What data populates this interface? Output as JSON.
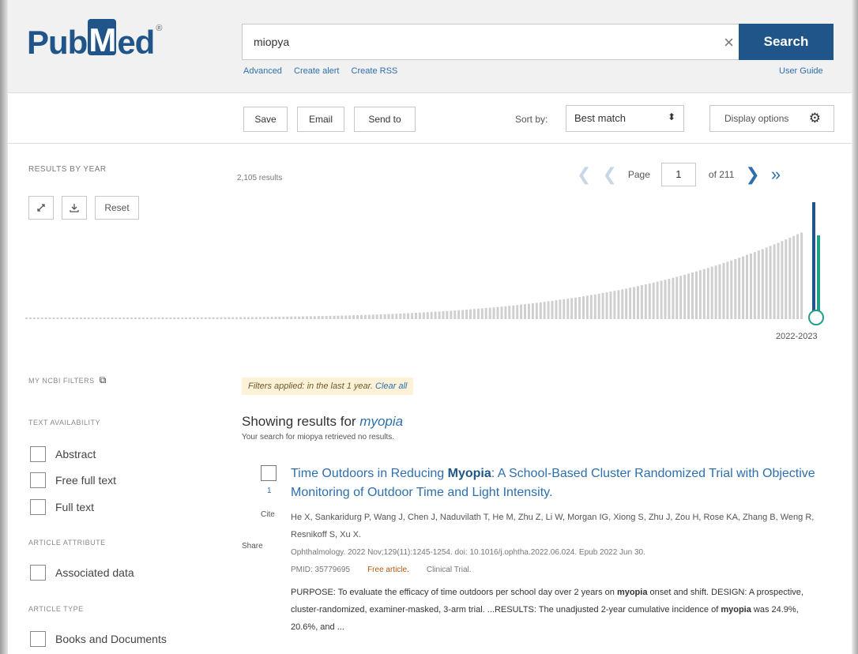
{
  "header": {
    "logo_pub": "Pub",
    "logo_m": "M",
    "logo_ed": "ed",
    "logo_reg": "®",
    "search_value": "miopya",
    "clear_glyph": "×",
    "search_button": "Search",
    "links": [
      "Advanced",
      "Create alert",
      "Create RSS"
    ],
    "user_guide": "User Guide"
  },
  "toolbar": {
    "save": "Save",
    "email": "Email",
    "send_to": "Send to",
    "sort_by_label": "Sort by:",
    "sort_value": "Best match",
    "display_options": "Display options"
  },
  "timeline": {
    "title": "RESULTS BY YEAR",
    "reset": "Reset",
    "results_count": "2,105 results",
    "page_label": "Page",
    "page_value": "1",
    "of_pages": "of 211",
    "year_range": "2022-2023",
    "accent_color": "#20a08a",
    "bar_color": "#cfcfcf"
  },
  "sidebar": {
    "my_ncbi_filters": "MY NCBI FILTERS",
    "text_availability": "TEXT AVAILABILITY",
    "text_options": [
      "Abstract",
      "Free full text",
      "Full text"
    ],
    "article_attribute": "ARTICLE ATTRIBUTE",
    "attribute_options": [
      "Associated data"
    ],
    "article_type": "ARTICLE TYPE",
    "type_options": [
      "Books and Documents"
    ]
  },
  "results": {
    "filter_note": "Filters applied: in the last 1 year.",
    "clear_all": "Clear all",
    "showing_prefix": "Showing results for ",
    "showing_term": "myopia",
    "no_results": "Your search for miopya retrieved no results.",
    "article": {
      "number": "1",
      "cite": "Cite",
      "share": "Share",
      "title_pre": "Time Outdoors in Reducing ",
      "title_bold": "Myopia",
      "title_post": ": A School-Based Cluster Randomized Trial with Objective Monitoring of Outdoor Time and Light Intensity.",
      "authors": "He X, Sankaridurg P, Wang J, Chen J, Naduvilath T, He M, Zhu Z, Li W, Morgan IG, Xiong S, Zhu J, Zou H, Rose KA, Zhang B, Weng R, Resnikoff S, Xu X.",
      "journal": "Ophthalmology. 2022 Nov;129(11):1245-1254. doi: 10.1016/j.ophtha.2022.06.024. Epub 2022 Jun 30.",
      "pmid": "PMID: 35779695",
      "free_article": "Free article.",
      "clinical_trial": "Clinical Trial.",
      "abstract_1": "PURPOSE: To evaluate the efficacy of time outdoors per school day over 2 years on ",
      "abstract_bold_1": "myopia",
      "abstract_2": " onset and shift. DESIGN: A prospective, cluster-randomized, examiner-masked, 3-arm trial. ...RESULTS: The unadjusted 2-year cumulative incidence of ",
      "abstract_bold_2": "myopia",
      "abstract_3": " was 24.9%, 20.6%, and ..."
    }
  }
}
